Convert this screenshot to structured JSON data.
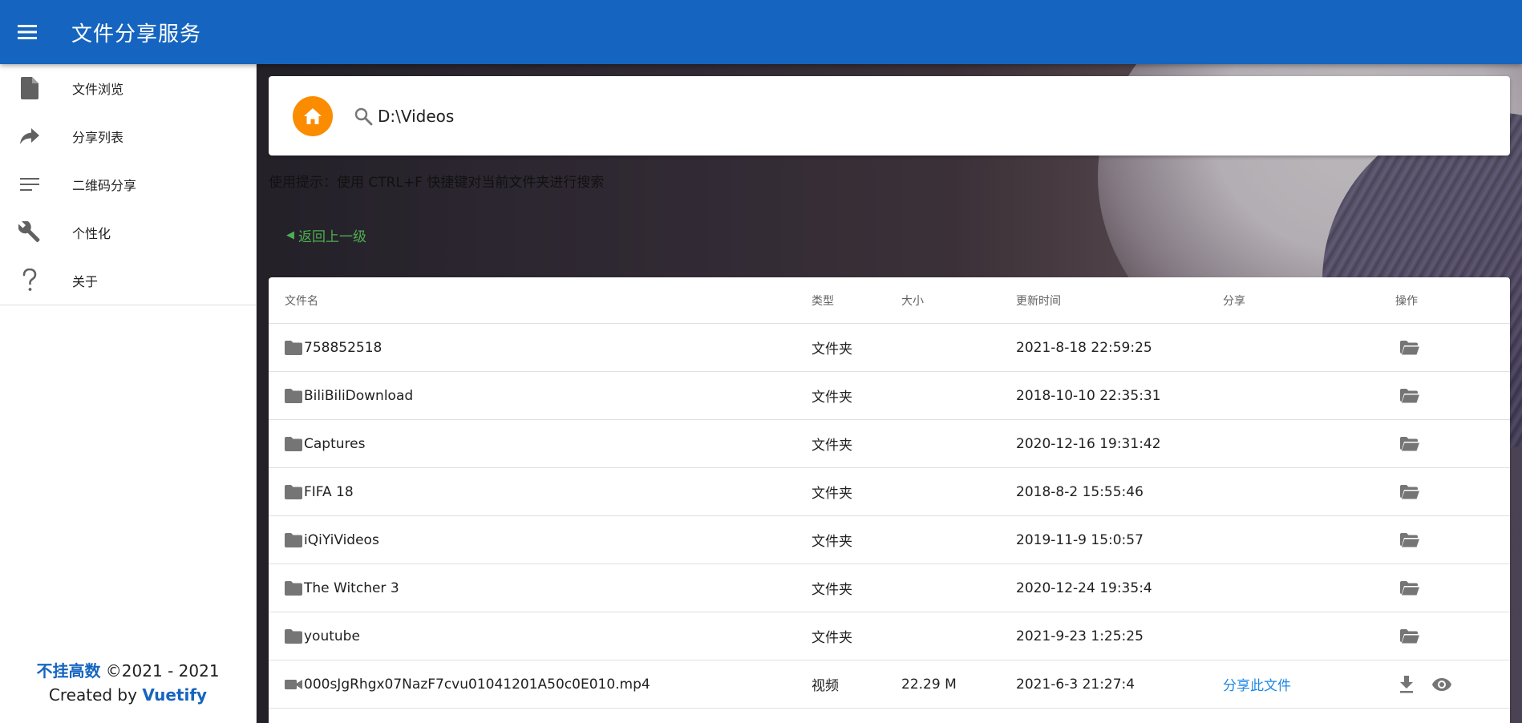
{
  "app": {
    "title": "文件分享服务",
    "brand_color": "#1565C0",
    "menu_icon": "menu-icon"
  },
  "sidebar": {
    "items": [
      {
        "label": "文件浏览",
        "icon": "file-icon"
      },
      {
        "label": "分享列表",
        "icon": "share-icon"
      },
      {
        "label": "二维码分享",
        "icon": "list-icon"
      },
      {
        "label": "个性化",
        "icon": "wrench-icon"
      },
      {
        "label": "关于",
        "icon": "help-icon"
      }
    ],
    "footer": {
      "brand": "不挂高数",
      "copyright": " ©2021 - 2021",
      "created_by": "Created by ",
      "framework": "Vuetify"
    }
  },
  "search": {
    "value": "D:\\Videos",
    "home_icon": "home-icon",
    "search_icon": "search-icon",
    "home_color": "#FB8C00"
  },
  "tip": "使用提示：使用 CTRL+F 快捷键对当前文件夹进行搜索",
  "back_link": "返回上一级",
  "table": {
    "headers": {
      "name": "文件名",
      "type": "类型",
      "size": "大小",
      "updated": "更新时间",
      "share": "分享",
      "actions": "操作"
    },
    "rows": [
      {
        "name": "758852518",
        "type": "文件夹",
        "size": "",
        "updated": "2021-8-18 22:59:25",
        "share": "",
        "kind": "folder"
      },
      {
        "name": "BiliBiliDownload",
        "type": "文件夹",
        "size": "",
        "updated": "2018-10-10 22:35:31",
        "share": "",
        "kind": "folder"
      },
      {
        "name": "Captures",
        "type": "文件夹",
        "size": "",
        "updated": "2020-12-16 19:31:42",
        "share": "",
        "kind": "folder"
      },
      {
        "name": "FIFA 18",
        "type": "文件夹",
        "size": "",
        "updated": "2018-8-2 15:55:46",
        "share": "",
        "kind": "folder"
      },
      {
        "name": "iQiYiVideos",
        "type": "文件夹",
        "size": "",
        "updated": "2019-11-9 15:0:57",
        "share": "",
        "kind": "folder"
      },
      {
        "name": "The Witcher 3",
        "type": "文件夹",
        "size": "",
        "updated": "2020-12-24 19:35:4",
        "share": "",
        "kind": "folder"
      },
      {
        "name": "youtube",
        "type": "文件夹",
        "size": "",
        "updated": "2021-9-23 1:25:25",
        "share": "",
        "kind": "folder"
      },
      {
        "name": "000sJgRhgx07NazF7cvu01041201A50c0E010.mp4",
        "type": "视频",
        "size": "22.29 M",
        "updated": "2021-6-3 21:27:4",
        "share": "分享此文件",
        "kind": "video"
      }
    ]
  }
}
